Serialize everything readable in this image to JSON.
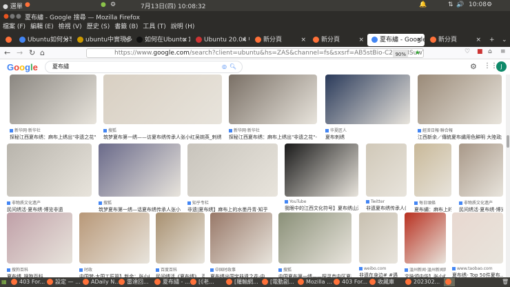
{
  "topbar": {
    "menu": "選單",
    "datetime": "7月13日(四) 10:08:32",
    "clock": "10:08"
  },
  "window": {
    "title": "夏布繡 - Google 搜尋 — Mozilla Firefox"
  },
  "menus": [
    "檔案 (F)",
    "編輯 (E)",
    "檢視 (V)",
    "歷史 (S)",
    "書籤 (B)",
    "工具 (T)",
    "說明 (H)"
  ],
  "tabs": [
    {
      "label": "Ubuntu如何分享"
    },
    {
      "label": "ubuntu中實現多"
    },
    {
      "label": "如何在Ubuntu 18"
    },
    {
      "label": "Ubuntu 20.04 中"
    },
    {
      "label": "新分頁"
    },
    {
      "label": "新分頁"
    },
    {
      "label": "夏布繡 - Google"
    },
    {
      "label": "新分頁"
    }
  ],
  "nav": {
    "url_prefix": "https://www.",
    "url_domain": "google.com",
    "url_rest": "/search?client=ubuntu&hs=ZAS&channel=fs&sxsrf=AB5stBio-C2H828SuwYZ3L1Ix9lKhs4jMg",
    "zoom": "90%"
  },
  "google": {
    "logo": "Google",
    "query": "夏布繡",
    "avatar": "J"
  },
  "results": [
    [
      {
        "src": "新华网·新华社",
        "cap": "探秘江西夏布绣：麻布上绣出\"非遗之花\"-新华网",
        "c": "#8a8680"
      },
      {
        "src": "搜狐",
        "cap": "筑梦夏布第一绣——访夏布绣传承人张小红吴婉英_刺绣",
        "c": "#d8cfc2"
      },
      {
        "src": "新华网·新华社",
        "cap": "探秘江西夏布绣：麻布上绣出\"非遗之花\"-新华网",
        "c": "#7a7066"
      },
      {
        "src": "华夏匠人",
        "cap": "夏布刺绣",
        "c": "#2a3a5a"
      },
      {
        "src": "經濟日報·聯合報",
        "cap": "江西新余／傳統夏布繡用色鮮明 大陸政經 兩...",
        "c": "#9a8a78"
      }
    ],
    [
      {
        "src": "非物质文化遗产",
        "cap": "民间绣活·夏布绣·博览非遗",
        "c": "#b8b4ac"
      },
      {
        "src": "搜狐",
        "cap": "筑梦夏布第一绣—话夏布绣传承人张小红...",
        "c": "#6a6a8a"
      },
      {
        "src": "知乎专栏",
        "cap": "非遗|夏布绣】麻布上的水墨丹青·知乎",
        "c": "#c8c4bc"
      },
      {
        "src": "YouTube",
        "cap": "我眼中的江西文化符号】夏布绣山河-...",
        "c": "#1a1a1a"
      },
      {
        "src": "Twitter",
        "cap": "非遗夏布绣传承人(...",
        "c": "#d0c8b8"
      },
      {
        "src": "每日頭條",
        "cap": "夏布繡：麻布上的水...",
        "c": "#c8b898"
      },
      {
        "src": "非物质文化遗产",
        "cap": "民间绣活·夏布绣·博览...",
        "c": "#a89888"
      }
    ],
    [
      {
        "src": "搜狗百科",
        "cap": "夏布绣_搜狗百科",
        "c": "#c0a0a8"
      },
      {
        "src": "时政",
        "cap": "中国梦·大国工匠篇】新余：张小红和...",
        "c": "#b89878"
      },
      {
        "src": "百度百科",
        "cap": "民间绣活《夏布绣》_百...",
        "c": "#a89070"
      },
      {
        "src": "中国时政事",
        "cap": "夏布绣出国宝非遗之花-中...",
        "c": "#987868"
      },
      {
        "src": "搜狐",
        "cap": "中国夏布第一绣——探寻市中区夏布绣...",
        "c": "#8a9078"
      },
      {
        "src": "weibo.com",
        "cap": "非遗在身边# #遇见...",
        "c": "#c8c0b0"
      },
      {
        "src": "温州新闻·温州新闻网",
        "cap": "文脉颂中华】张小红：夏...",
        "c": "#b83020"
      },
      {
        "src": "www.taobao.com",
        "cap": "夏布绣- Top 50件夏布...",
        "c": "#e8d8d0"
      }
    ]
  ],
  "taskbar": [
    "403 For...",
    "設定 — ...",
    "ADaily N...",
    "雷達回...",
    "夏布繡 - ...",
    "[《老...",
    "[羅輸網...",
    "[電動副...",
    "Mozilla ...",
    "403 For...",
    "收藏庫",
    "202302..."
  ]
}
